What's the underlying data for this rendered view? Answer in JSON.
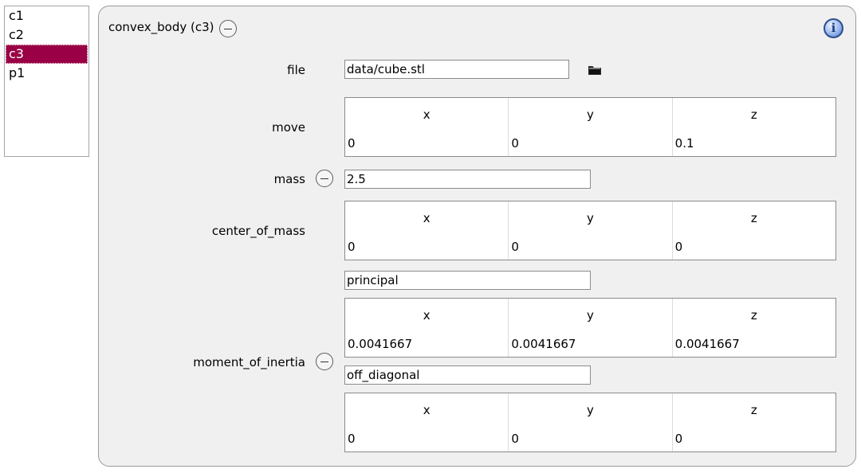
{
  "list": {
    "items": [
      "c1",
      "c2",
      "c3",
      "p1"
    ],
    "selected_index": 2,
    "selected_color": "#990045"
  },
  "panel": {
    "title": "convex_body (c3)",
    "file": {
      "label": "file",
      "value": "data/cube.stl",
      "browse_icon": "folder-icon"
    },
    "move": {
      "label": "move",
      "headers": [
        "x",
        "y",
        "z"
      ],
      "values": [
        "0",
        "0",
        "0.1"
      ]
    },
    "mass": {
      "label": "mass",
      "value": "2.5"
    },
    "center_of_mass": {
      "label": "center_of_mass",
      "headers": [
        "x",
        "y",
        "z"
      ],
      "values": [
        "0",
        "0",
        "0"
      ]
    },
    "moment_of_inertia": {
      "label": "moment_of_inertia",
      "principal": {
        "label": "principal",
        "headers": [
          "x",
          "y",
          "z"
        ],
        "values": [
          "0.0041667",
          "0.0041667",
          "0.0041667"
        ]
      },
      "off_diagonal": {
        "label": "off_diagonal",
        "headers": [
          "x",
          "y",
          "z"
        ],
        "values": [
          "0",
          "0",
          "0"
        ]
      }
    },
    "info_icon": "info-icon",
    "info_glyph": "i"
  }
}
